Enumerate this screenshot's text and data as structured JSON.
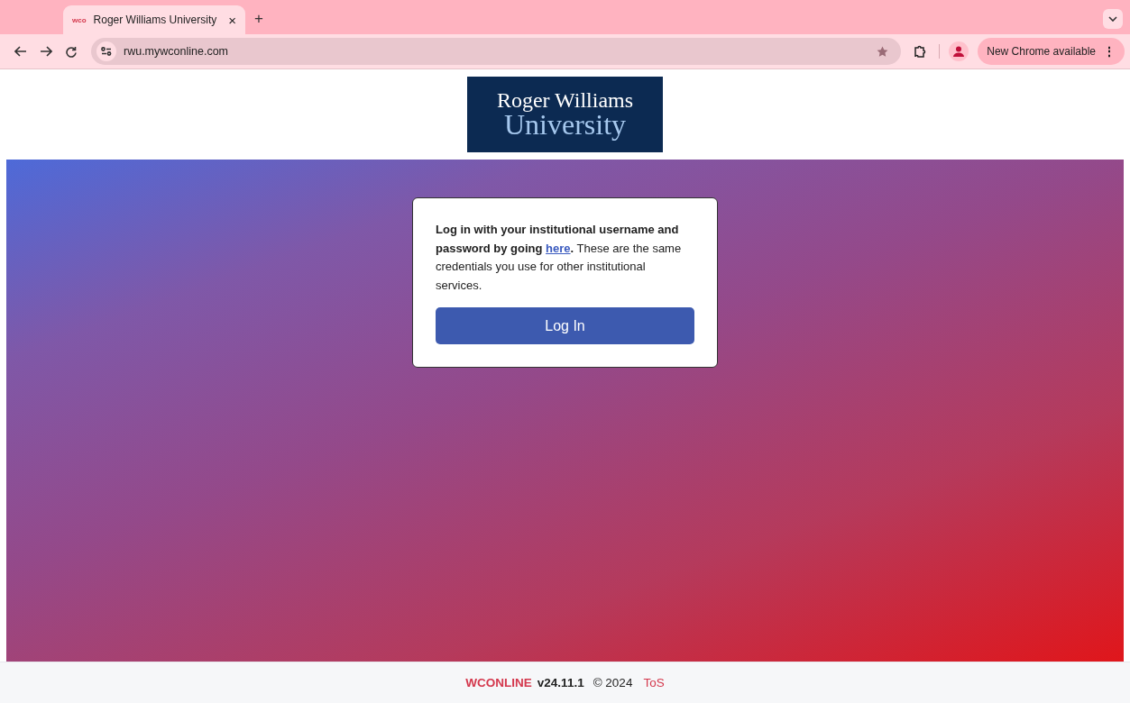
{
  "browser": {
    "tab": {
      "favicon": "wco",
      "title": "Roger Williams University",
      "close": "×",
      "selected": true
    },
    "new_tab": "+",
    "url": "rwu.mywconline.com",
    "update_button": "New Chrome available",
    "menu": "⋮"
  },
  "logo": {
    "line_1": "Roger Williams",
    "line_2": "University"
  },
  "login": {
    "text_before": "Log in with your institutional username and password by going",
    "link": "here",
    "text_after": "**.** These are the same credentials you use for other institutional services.",
    "button": "Log In"
  },
  "footer": {
    "brand": "WCONLINE",
    "version": "v24.11.1",
    "copyright": "© 2024",
    "tos": "ToS"
  }
}
